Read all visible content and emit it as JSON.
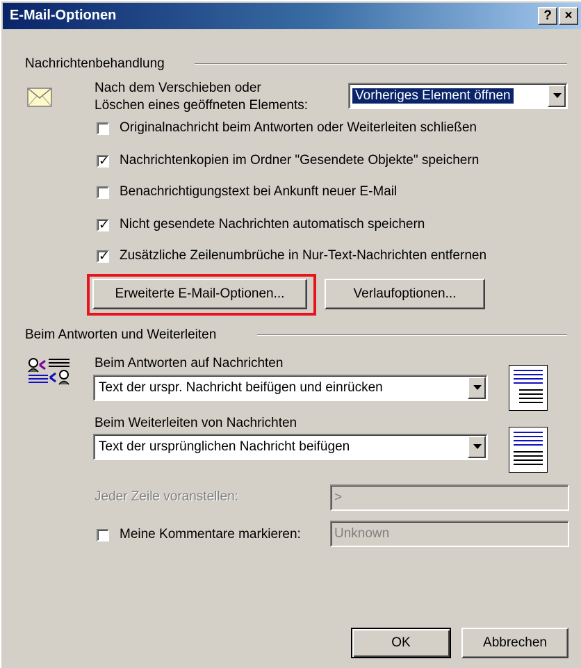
{
  "dialog": {
    "title": "E-Mail-Optionen",
    "help_label": "?",
    "close_label": "×"
  },
  "message_handling": {
    "group_label": "Nachrichtenbehandlung",
    "after_move_label_line1": "Nach dem Verschieben oder",
    "after_move_label_line2": "Löschen eines geöffneten Elements:",
    "after_move_value": "Vorheriges Element öffnen",
    "checkboxes": [
      {
        "label": "Originalnachricht beim Antworten oder Weiterleiten schließen",
        "checked": false
      },
      {
        "label": "Nachrichtenkopien im Ordner \"Gesendete Objekte\" speichern",
        "checked": true
      },
      {
        "label": "Benachrichtigungstext bei Ankunft neuer E-Mail",
        "checked": false
      },
      {
        "label": "Nicht gesendete Nachrichten automatisch speichern",
        "checked": true
      },
      {
        "label": "Zusätzliche Zeilenumbrüche in Nur-Text-Nachrichten entfernen",
        "checked": true
      }
    ],
    "advanced_button": "Erweiterte E-Mail-Optionen...",
    "tracking_button": "Verlaufoptionen..."
  },
  "reply_forward": {
    "group_label": "Beim Antworten und Weiterleiten",
    "reply_label": "Beim Antworten auf Nachrichten",
    "reply_value": "Text der urspr. Nachricht beifügen und einrücken",
    "forward_label": "Beim Weiterleiten von Nachrichten",
    "forward_value": "Text der ursprünglichen Nachricht beifügen",
    "prefix_label": "Jeder Zeile voranstellen:",
    "prefix_value": ">",
    "mark_comments_label": "Meine Kommentare markieren:",
    "mark_comments_checked": false,
    "mark_comments_value": "Unknown"
  },
  "footer": {
    "ok_label": "OK",
    "cancel_label": "Abbrechen"
  },
  "colors": {
    "highlight": "#e8141c",
    "titlebar": "#0a246a",
    "face": "#d4d0c8"
  }
}
